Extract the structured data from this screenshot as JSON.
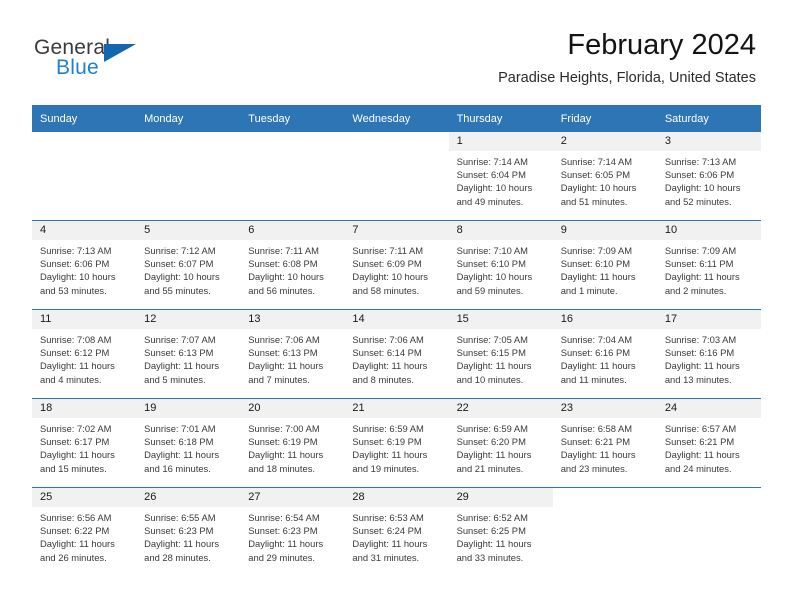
{
  "brand": {
    "name_top": "General",
    "name_bottom": "Blue",
    "triangle_color": "#1566b0",
    "blue_text_color": "#1f7fd0"
  },
  "header": {
    "month_title": "February 2024",
    "location": "Paradise Heights, Florida, United States",
    "accent_color": "#2e75b6",
    "daynum_band_color": "#f1f1f1"
  },
  "weekday_headers": [
    "Sunday",
    "Monday",
    "Tuesday",
    "Wednesday",
    "Thursday",
    "Friday",
    "Saturday"
  ],
  "labels": {
    "sunrise_prefix": "Sunrise:",
    "sunset_prefix": "Sunset:",
    "daylight_prefix": "Daylight:"
  },
  "weeks": [
    [
      {
        "day": "",
        "blank": true
      },
      {
        "day": "",
        "blank": true
      },
      {
        "day": "",
        "blank": true
      },
      {
        "day": "",
        "blank": true
      },
      {
        "day": "1",
        "sunrise": "Sunrise: 7:14 AM",
        "sunset": "Sunset: 6:04 PM",
        "daylight_1": "Daylight: 10 hours",
        "daylight_2": "and 49 minutes."
      },
      {
        "day": "2",
        "sunrise": "Sunrise: 7:14 AM",
        "sunset": "Sunset: 6:05 PM",
        "daylight_1": "Daylight: 10 hours",
        "daylight_2": "and 51 minutes."
      },
      {
        "day": "3",
        "sunrise": "Sunrise: 7:13 AM",
        "sunset": "Sunset: 6:06 PM",
        "daylight_1": "Daylight: 10 hours",
        "daylight_2": "and 52 minutes."
      }
    ],
    [
      {
        "day": "4",
        "sunrise": "Sunrise: 7:13 AM",
        "sunset": "Sunset: 6:06 PM",
        "daylight_1": "Daylight: 10 hours",
        "daylight_2": "and 53 minutes."
      },
      {
        "day": "5",
        "sunrise": "Sunrise: 7:12 AM",
        "sunset": "Sunset: 6:07 PM",
        "daylight_1": "Daylight: 10 hours",
        "daylight_2": "and 55 minutes."
      },
      {
        "day": "6",
        "sunrise": "Sunrise: 7:11 AM",
        "sunset": "Sunset: 6:08 PM",
        "daylight_1": "Daylight: 10 hours",
        "daylight_2": "and 56 minutes."
      },
      {
        "day": "7",
        "sunrise": "Sunrise: 7:11 AM",
        "sunset": "Sunset: 6:09 PM",
        "daylight_1": "Daylight: 10 hours",
        "daylight_2": "and 58 minutes."
      },
      {
        "day": "8",
        "sunrise": "Sunrise: 7:10 AM",
        "sunset": "Sunset: 6:10 PM",
        "daylight_1": "Daylight: 10 hours",
        "daylight_2": "and 59 minutes."
      },
      {
        "day": "9",
        "sunrise": "Sunrise: 7:09 AM",
        "sunset": "Sunset: 6:10 PM",
        "daylight_1": "Daylight: 11 hours",
        "daylight_2": "and 1 minute."
      },
      {
        "day": "10",
        "sunrise": "Sunrise: 7:09 AM",
        "sunset": "Sunset: 6:11 PM",
        "daylight_1": "Daylight: 11 hours",
        "daylight_2": "and 2 minutes."
      }
    ],
    [
      {
        "day": "11",
        "sunrise": "Sunrise: 7:08 AM",
        "sunset": "Sunset: 6:12 PM",
        "daylight_1": "Daylight: 11 hours",
        "daylight_2": "and 4 minutes."
      },
      {
        "day": "12",
        "sunrise": "Sunrise: 7:07 AM",
        "sunset": "Sunset: 6:13 PM",
        "daylight_1": "Daylight: 11 hours",
        "daylight_2": "and 5 minutes."
      },
      {
        "day": "13",
        "sunrise": "Sunrise: 7:06 AM",
        "sunset": "Sunset: 6:13 PM",
        "daylight_1": "Daylight: 11 hours",
        "daylight_2": "and 7 minutes."
      },
      {
        "day": "14",
        "sunrise": "Sunrise: 7:06 AM",
        "sunset": "Sunset: 6:14 PM",
        "daylight_1": "Daylight: 11 hours",
        "daylight_2": "and 8 minutes."
      },
      {
        "day": "15",
        "sunrise": "Sunrise: 7:05 AM",
        "sunset": "Sunset: 6:15 PM",
        "daylight_1": "Daylight: 11 hours",
        "daylight_2": "and 10 minutes."
      },
      {
        "day": "16",
        "sunrise": "Sunrise: 7:04 AM",
        "sunset": "Sunset: 6:16 PM",
        "daylight_1": "Daylight: 11 hours",
        "daylight_2": "and 11 minutes."
      },
      {
        "day": "17",
        "sunrise": "Sunrise: 7:03 AM",
        "sunset": "Sunset: 6:16 PM",
        "daylight_1": "Daylight: 11 hours",
        "daylight_2": "and 13 minutes."
      }
    ],
    [
      {
        "day": "18",
        "sunrise": "Sunrise: 7:02 AM",
        "sunset": "Sunset: 6:17 PM",
        "daylight_1": "Daylight: 11 hours",
        "daylight_2": "and 15 minutes."
      },
      {
        "day": "19",
        "sunrise": "Sunrise: 7:01 AM",
        "sunset": "Sunset: 6:18 PM",
        "daylight_1": "Daylight: 11 hours",
        "daylight_2": "and 16 minutes."
      },
      {
        "day": "20",
        "sunrise": "Sunrise: 7:00 AM",
        "sunset": "Sunset: 6:19 PM",
        "daylight_1": "Daylight: 11 hours",
        "daylight_2": "and 18 minutes."
      },
      {
        "day": "21",
        "sunrise": "Sunrise: 6:59 AM",
        "sunset": "Sunset: 6:19 PM",
        "daylight_1": "Daylight: 11 hours",
        "daylight_2": "and 19 minutes."
      },
      {
        "day": "22",
        "sunrise": "Sunrise: 6:59 AM",
        "sunset": "Sunset: 6:20 PM",
        "daylight_1": "Daylight: 11 hours",
        "daylight_2": "and 21 minutes."
      },
      {
        "day": "23",
        "sunrise": "Sunrise: 6:58 AM",
        "sunset": "Sunset: 6:21 PM",
        "daylight_1": "Daylight: 11 hours",
        "daylight_2": "and 23 minutes."
      },
      {
        "day": "24",
        "sunrise": "Sunrise: 6:57 AM",
        "sunset": "Sunset: 6:21 PM",
        "daylight_1": "Daylight: 11 hours",
        "daylight_2": "and 24 minutes."
      }
    ],
    [
      {
        "day": "25",
        "sunrise": "Sunrise: 6:56 AM",
        "sunset": "Sunset: 6:22 PM",
        "daylight_1": "Daylight: 11 hours",
        "daylight_2": "and 26 minutes."
      },
      {
        "day": "26",
        "sunrise": "Sunrise: 6:55 AM",
        "sunset": "Sunset: 6:23 PM",
        "daylight_1": "Daylight: 11 hours",
        "daylight_2": "and 28 minutes."
      },
      {
        "day": "27",
        "sunrise": "Sunrise: 6:54 AM",
        "sunset": "Sunset: 6:23 PM",
        "daylight_1": "Daylight: 11 hours",
        "daylight_2": "and 29 minutes."
      },
      {
        "day": "28",
        "sunrise": "Sunrise: 6:53 AM",
        "sunset": "Sunset: 6:24 PM",
        "daylight_1": "Daylight: 11 hours",
        "daylight_2": "and 31 minutes."
      },
      {
        "day": "29",
        "sunrise": "Sunrise: 6:52 AM",
        "sunset": "Sunset: 6:25 PM",
        "daylight_1": "Daylight: 11 hours",
        "daylight_2": "and 33 minutes."
      },
      {
        "day": "",
        "blank": true
      },
      {
        "day": "",
        "blank": true
      }
    ]
  ]
}
